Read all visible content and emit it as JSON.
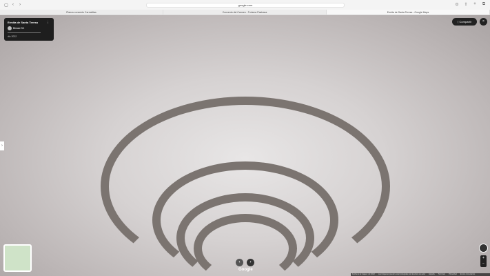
{
  "browser": {
    "url": "google.com",
    "tabs": [
      "Planos convento Carmelitas",
      "Convento del Carmen - Turismo Pastrana",
      "Ermita de Santa Teresa - Google Maps"
    ]
  },
  "card": {
    "title": "Ermita de Santa Teresa",
    "author": "Birsaw SC",
    "date": "dic 2022"
  },
  "share_label": "Compartir",
  "logo": "Google",
  "footer": {
    "date": "Fecha de la imagen: dic 2022",
    "copyright": "Las imágenes pueden estar protegidas por derechos de autor",
    "links": [
      "España",
      "Términos",
      "Privacidad",
      "Enviar comentarios"
    ]
  }
}
